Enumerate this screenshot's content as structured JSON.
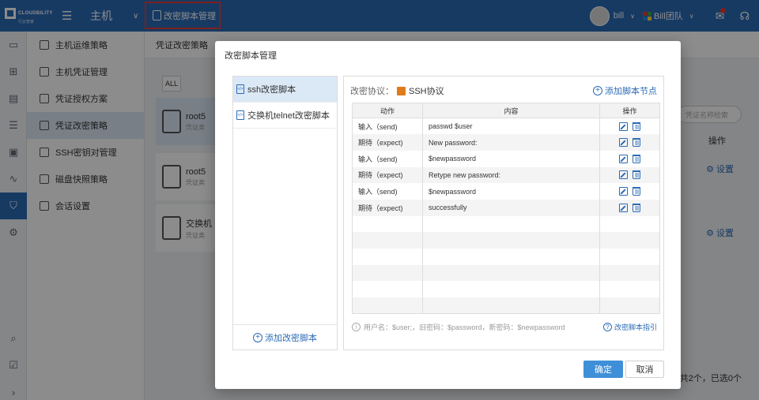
{
  "app": {
    "brand": "CLOUDBILITY",
    "brand_sub": "行云管家",
    "section_title": "主机",
    "active_tab_label": "改密脚本管理",
    "user_name": "bill",
    "team_name": "Bill团队"
  },
  "subnav": {
    "items": [
      {
        "label": "主机运维策略",
        "icon": "shield-icon"
      },
      {
        "label": "主机凭证管理",
        "icon": "key-icon"
      },
      {
        "label": "凭证授权方案",
        "icon": "document-icon"
      },
      {
        "label": "凭证改密策略",
        "icon": "document-edit-icon"
      },
      {
        "label": "SSH密钥对管理",
        "icon": "key-pair-icon"
      },
      {
        "label": "磁盘快照策略",
        "icon": "disk-icon"
      },
      {
        "label": "会话设置",
        "icon": "window-icon"
      }
    ]
  },
  "background": {
    "header_title": "凭证改密策略",
    "all_label": "ALL",
    "search_placeholder": "凭证名称检索",
    "op_header": "操作",
    "setting_label": "设置",
    "cards": [
      {
        "title": "root5",
        "sub": "凭证类"
      },
      {
        "title": "root5",
        "sub": "凭证类"
      },
      {
        "title": "交换机",
        "sub": "凭证类"
      }
    ],
    "footer": "共2个，已选0个"
  },
  "modal": {
    "title": "改密脚本管理",
    "scripts": [
      {
        "label": "ssh改密脚本",
        "active": true
      },
      {
        "label": "交换机telnet改密脚本",
        "active": false
      }
    ],
    "add_script_label": "添加改密脚本",
    "protocol_label": "改密协议：",
    "protocol_value": "SSH协议",
    "add_node_label": "添加脚本节点",
    "table": {
      "headers": [
        "动作",
        "内容",
        "操作"
      ],
      "rows": [
        {
          "action": "输入（send)",
          "content": "passwd $user"
        },
        {
          "action": "期待（expect)",
          "content": "New password:"
        },
        {
          "action": "输入（send)",
          "content": "$newpassword"
        },
        {
          "action": "期待（expect)",
          "content": "Retype new password:"
        },
        {
          "action": "输入（send)",
          "content": "$newpassword"
        },
        {
          "action": "期待（expect)",
          "content": "successfully"
        }
      ],
      "empty_rows": 6
    },
    "hint": "用户名：$user;，旧密码：$password，新密码：$newpassword",
    "guide_label": "改密脚本指引",
    "ok_label": "确定",
    "cancel_label": "取消"
  },
  "colors": {
    "primary": "#2b6bb5",
    "highlight_border": "#e53935",
    "selected_bg": "#dbe8f6",
    "ok_button": "#3f8fd8"
  }
}
